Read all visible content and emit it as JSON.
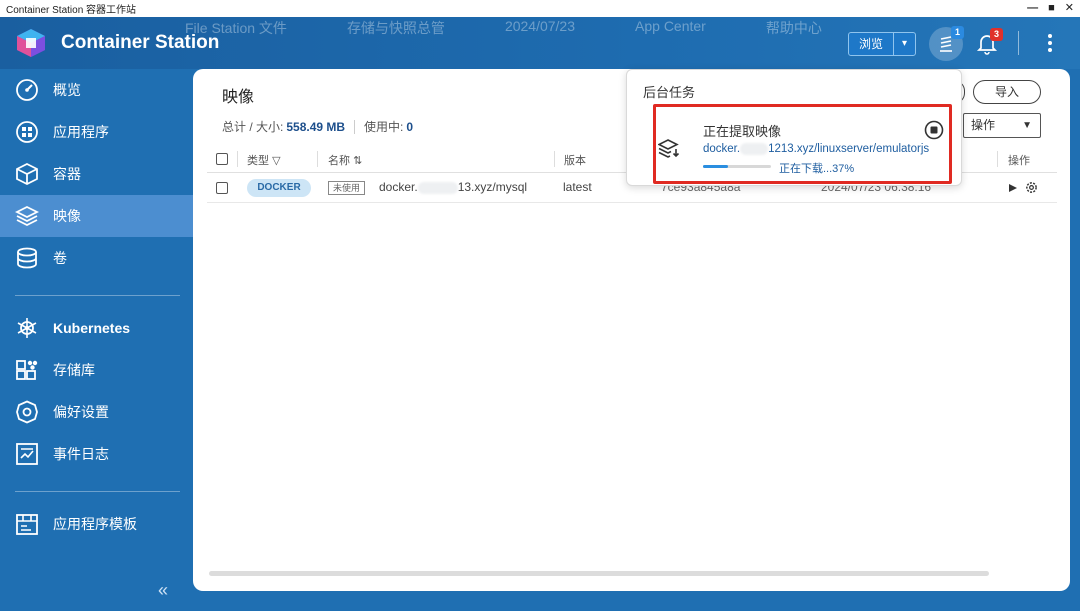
{
  "window": {
    "title": "Container Station 容器工作站",
    "background_tabs": [
      "File Station 文件",
      "存储与快照总管",
      "2024/07/23",
      "App Center",
      "帮助中心"
    ],
    "buttons": {
      "minimize": "—",
      "maximize": "■",
      "close": "✕"
    }
  },
  "header": {
    "app_title": "Container Station",
    "browse_label": "浏览",
    "browse_caret": "▾",
    "tasks_badge": "1",
    "notifications_badge": "3",
    "colors": {
      "bar": "#1e6cb0",
      "badge_blue": "#2b8ae0",
      "badge_red": "#e0302b"
    }
  },
  "sidebar": {
    "items": [
      {
        "label": "概览",
        "icon": "gauge-icon"
      },
      {
        "label": "应用程序",
        "icon": "apps-icon"
      },
      {
        "label": "容器",
        "icon": "cube-icon"
      },
      {
        "label": "映像",
        "icon": "layers-icon",
        "active": true
      },
      {
        "label": "卷",
        "icon": "database-icon"
      },
      {
        "label": "Kubernetes",
        "icon": "helm-icon"
      },
      {
        "label": "存储库",
        "icon": "registry-icon"
      },
      {
        "label": "偏好设置",
        "icon": "settings-icon"
      },
      {
        "label": "事件日志",
        "icon": "log-icon"
      },
      {
        "label": "应用程序模板",
        "icon": "template-icon"
      }
    ],
    "collapse": "«"
  },
  "main": {
    "title": "映像",
    "summary": {
      "total_label": "总计 / 大小:",
      "total_value": "558.49 MB",
      "in_use_label": "使用中:",
      "in_use_value": "0"
    },
    "import_label": "导入",
    "ops_label": "操作",
    "table": {
      "headers": {
        "type": "类型",
        "name": "名称",
        "version": "版本",
        "actions": "操作"
      },
      "rows": [
        {
          "type": "DOCKER",
          "tag": "未使用",
          "name_prefix": "docker.",
          "name_suffix": "13.xyz/mysql",
          "version": "latest",
          "id": "7ce93a845a8a",
          "created": "2024/07/23 06:38:16"
        }
      ]
    }
  },
  "tasks_popup": {
    "title": "后台任务",
    "task": {
      "title": "正在提取映像",
      "path_prefix": "docker.",
      "path_suffix": "1213.xyz/linuxserver/emulatorjs",
      "status": "正在下载...37%",
      "progress": 0.37
    }
  }
}
